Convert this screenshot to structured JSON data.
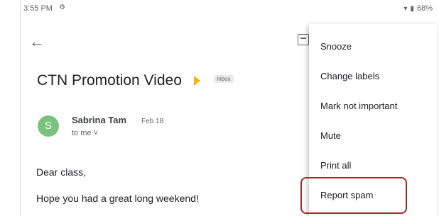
{
  "status_bar": {
    "time": "3:55 PM",
    "settings_icon": "settings-icon",
    "battery": "68%"
  },
  "toolbar": {
    "back_icon": "arrow-left-icon",
    "archive_icon": "archive-icon"
  },
  "email": {
    "subject": "CTN Promotion Video",
    "label": "Inbox",
    "sender": {
      "initial": "S",
      "name": "Sabrina Tam",
      "date": "Feb 18",
      "recipient": "to me",
      "avatar_color": "#7cc27f"
    },
    "greeting": "Dear class,",
    "body_line": "Hope you had a great long weekend!"
  },
  "menu": {
    "items": [
      {
        "label": "Snooze"
      },
      {
        "label": "Change labels"
      },
      {
        "label": "Mark not important"
      },
      {
        "label": "Mute"
      },
      {
        "label": "Print all"
      },
      {
        "label": "Report spam"
      }
    ]
  },
  "colors": {
    "highlight": "#9d2a2a",
    "important": "#f4b400"
  }
}
